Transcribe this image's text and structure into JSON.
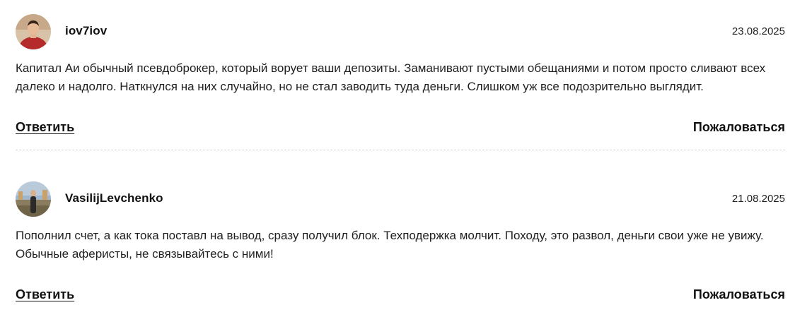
{
  "comments": [
    {
      "username": "iov7iov",
      "date": "23.08.2025",
      "avatar_icon": "user-avatar-red-shirt",
      "text": "Капитал Аи обычный псевдоброкер, который ворует ваши депозиты. Заманивают пустыми обещаниями и потом просто сливают всех далеко и надолго. Наткнулся на них случайно, но не стал заводить туда деньги. Слишком уж все подозрительно выглядит.",
      "reply_label": "Ответить",
      "report_label": "Пожаловаться"
    },
    {
      "username": "VasilijLevchenko",
      "date": "21.08.2025",
      "avatar_icon": "user-avatar-outdoor-photo",
      "text": "Пополнил счет, а как тока поставл на вывод, сразу получил блок. Техподержка молчит. Походу, это развол, деньги свои уже не увижу. Обычные аферисты, не связывайтесь с ними!",
      "reply_label": "Ответить",
      "report_label": "Пожаловаться"
    }
  ],
  "colors": {
    "text": "#1f1f1f",
    "divider": "#d6d6d6",
    "background": "#ffffff"
  }
}
